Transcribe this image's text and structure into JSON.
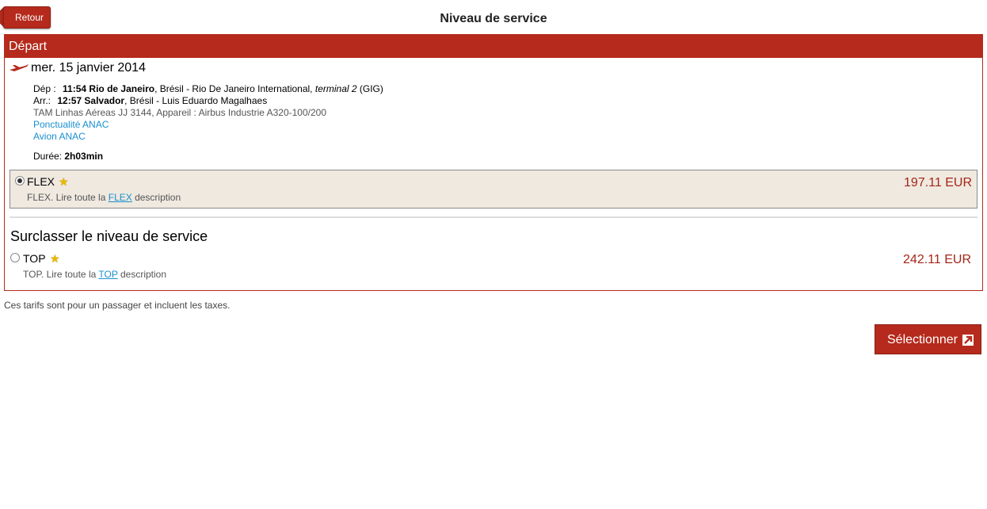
{
  "header": {
    "back_label": "Retour",
    "title": "Niveau de service"
  },
  "panel": {
    "title": "Départ",
    "date": "mer. 15 janvier 2014",
    "departure": {
      "label": "Dép :",
      "time": "11:54",
      "city": "Rio de Janeiro",
      "rest": ", Brésil - Rio De Janeiro International, ",
      "terminal": "terminal 2",
      "code": " (GIG)"
    },
    "arrival": {
      "label": "Arr.:",
      "time": "12:57",
      "city": "Salvador",
      "rest": ", Brésil - Luis Eduardo Magalhaes"
    },
    "flight_info": "TAM Linhas Aéreas JJ 3144, Appareil : Airbus Industrie A320-100/200",
    "link_punctuality": "Ponctualité ANAC",
    "link_aircraft": "Avion ANAC",
    "duration_label": "Durée:",
    "duration_value": "2h03min",
    "selected_fare": {
      "name": "FLEX",
      "desc_prefix": "FLEX. Lire toute la ",
      "desc_link": "FLEX",
      "desc_suffix": " description",
      "price": "197.11 EUR",
      "selected": true
    },
    "upgrade_title": "Surclasser le niveau de service",
    "upgrade_fare": {
      "name": "TOP",
      "desc_prefix": "TOP. Lire toute la ",
      "desc_link": "TOP",
      "desc_suffix": " description",
      "price": "242.11 EUR",
      "selected": false
    }
  },
  "note": "Ces tarifs sont pour un passager et incluent les taxes.",
  "select_label": "Sélectionner",
  "colors": {
    "brand": "#b52a1c",
    "price": "#a52518",
    "link": "#1a8fcf",
    "selected_bg": "#efe9e0"
  }
}
